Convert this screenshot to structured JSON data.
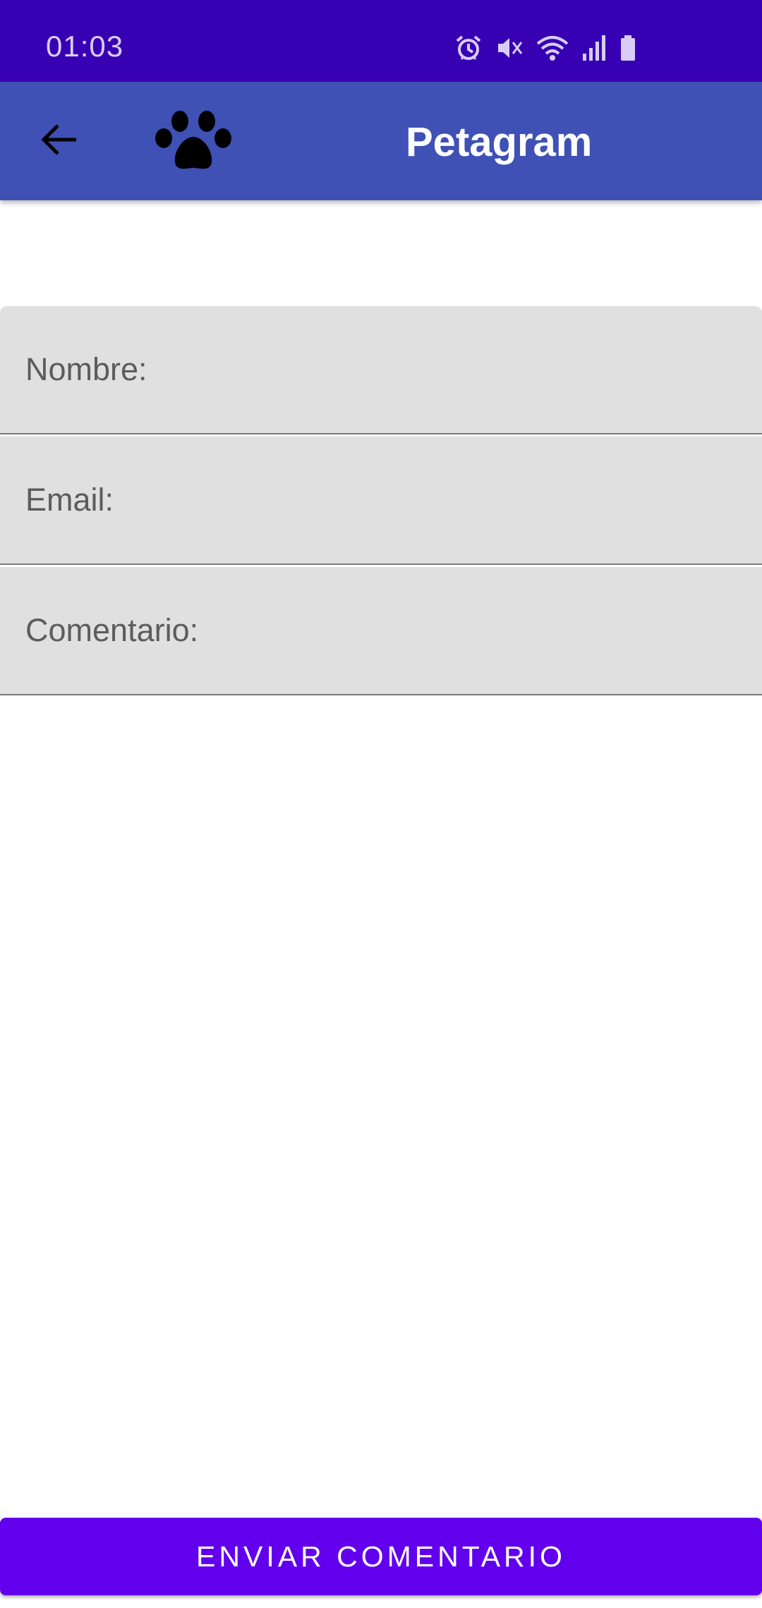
{
  "status_bar": {
    "time": "01:03",
    "icons": [
      "alarm-icon",
      "mute-icon",
      "wifi-icon",
      "signal-icon",
      "battery-icon"
    ]
  },
  "app_bar": {
    "title": "Petagram",
    "back_icon": "arrow-left-icon",
    "logo_icon": "paw-icon"
  },
  "form": {
    "name_placeholder": "Nombre:",
    "email_placeholder": "Email:",
    "comment_placeholder": "Comentario:",
    "name_value": "",
    "email_value": "",
    "comment_value": ""
  },
  "actions": {
    "send_label": "ENVIAR COMENTARIO"
  },
  "colors": {
    "status_bar": "#3700b3",
    "app_bar": "#3f51b5",
    "field_bg": "#e0e0e0",
    "button": "#6200ee"
  }
}
